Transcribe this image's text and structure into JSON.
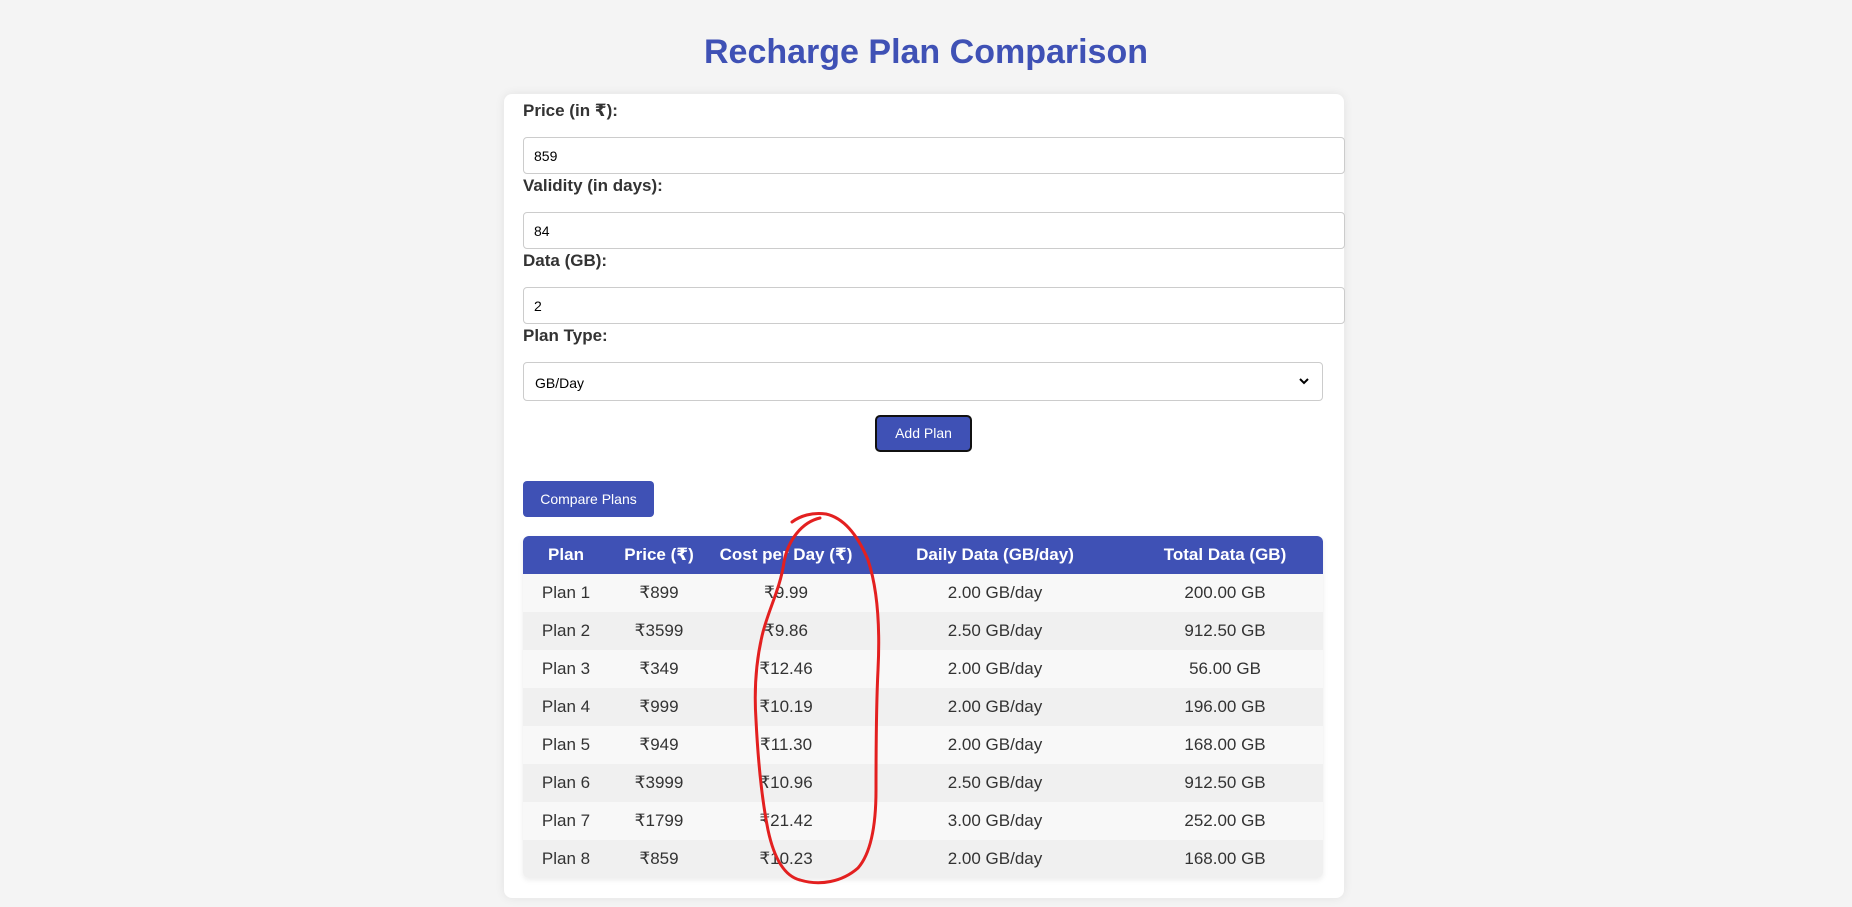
{
  "page": {
    "title": "Recharge Plan Comparison"
  },
  "form": {
    "price": {
      "label": "Price (in ₹):",
      "value": "859"
    },
    "validity": {
      "label": "Validity (in days):",
      "value": "84"
    },
    "data": {
      "label": "Data (GB):",
      "value": "2"
    },
    "plan_type": {
      "label": "Plan Type:",
      "selected": "GB/Day"
    },
    "add_button_label": "Add Plan"
  },
  "compare_button_label": "Compare Plans",
  "table": {
    "headers": [
      "Plan",
      "Price (₹)",
      "Cost per Day (₹)",
      "Daily Data (GB/day)",
      "Total Data (GB)"
    ],
    "rows": [
      [
        "Plan 1",
        "₹899",
        "₹9.99",
        "2.00 GB/day",
        "200.00 GB"
      ],
      [
        "Plan 2",
        "₹3599",
        "₹9.86",
        "2.50 GB/day",
        "912.50 GB"
      ],
      [
        "Plan 3",
        "₹349",
        "₹12.46",
        "2.00 GB/day",
        "56.00 GB"
      ],
      [
        "Plan 4",
        "₹999",
        "₹10.19",
        "2.00 GB/day",
        "196.00 GB"
      ],
      [
        "Plan 5",
        "₹949",
        "₹11.30",
        "2.00 GB/day",
        "168.00 GB"
      ],
      [
        "Plan 6",
        "₹3999",
        "₹10.96",
        "2.50 GB/day",
        "912.50 GB"
      ],
      [
        "Plan 7",
        "₹1799",
        "₹21.42",
        "3.00 GB/day",
        "252.00 GB"
      ],
      [
        "Plan 8",
        "₹859",
        "₹10.23",
        "2.00 GB/day",
        "168.00 GB"
      ]
    ]
  },
  "colors": {
    "accent": "#3f51b5",
    "annotation": "#e32020",
    "background": "#f4f4f4"
  }
}
